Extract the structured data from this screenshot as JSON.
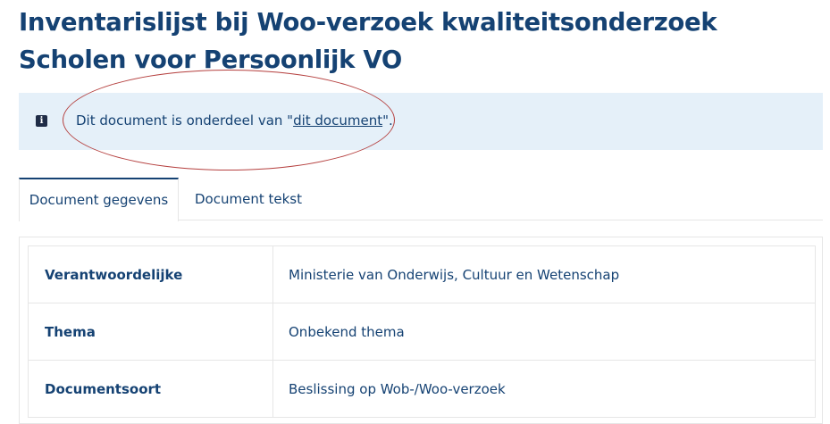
{
  "page": {
    "title": "Inventarislijst bij Woo-verzoek kwaliteitsonderzoek Scholen voor Persoonlijk VO"
  },
  "notice": {
    "icon": "info-icon",
    "icon_glyph": "i",
    "text_before": "Dit document is onderdeel van \"",
    "link_text": "dit document",
    "text_after": "\"."
  },
  "tabs": [
    {
      "label": "Document gegevens",
      "active": true
    },
    {
      "label": "Document tekst",
      "active": false
    }
  ],
  "details": {
    "rows": [
      {
        "label": "Verantwoordelijke",
        "value": "Ministerie van Onderwijs, Cultuur en Wetenschap"
      },
      {
        "label": "Thema",
        "value": "Onbekend thema"
      },
      {
        "label": "Documentsoort",
        "value": "Beslissing op Wob-/Woo-verzoek"
      }
    ]
  },
  "colors": {
    "primary": "#154273",
    "notice_background": "#e5f0f9",
    "annotation": "#b5403f"
  }
}
